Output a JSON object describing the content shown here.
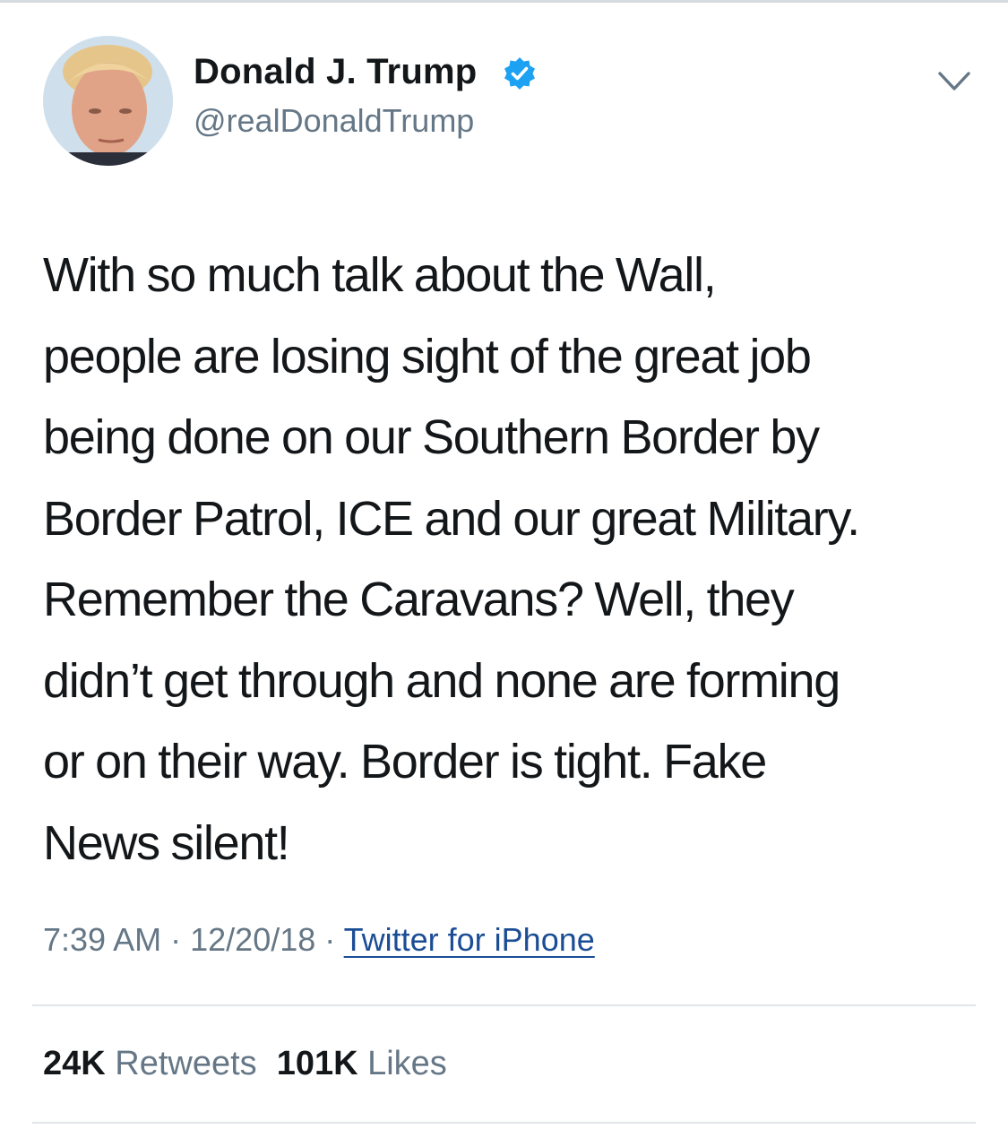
{
  "author": {
    "display_name": "Donald J. Trump",
    "handle": "@realDonaldTrump",
    "avatar_icon": "profile-photo",
    "verified_icon": "verified-badge-icon",
    "verified_color": "#1da1f2"
  },
  "menu": {
    "icon": "chevron-down-icon"
  },
  "tweet": {
    "lines": [
      "With so much talk about the Wall,",
      "people are losing sight of the great job",
      "being done on our Southern Border by",
      "Border Patrol, ICE and our great Military.",
      "Remember the Caravans? Well, they",
      "didn’t get through and none are forming",
      "or on their way. Border is tight. Fake",
      "News silent!"
    ]
  },
  "meta": {
    "time": "7:39 AM",
    "separator": "·",
    "date": "12/20/18",
    "source": "Twitter for iPhone",
    "source_color": "#1b4d95"
  },
  "stats": {
    "retweets_count": "24K",
    "retweets_label": "Retweets",
    "likes_count": "101K",
    "likes_label": "Likes"
  }
}
